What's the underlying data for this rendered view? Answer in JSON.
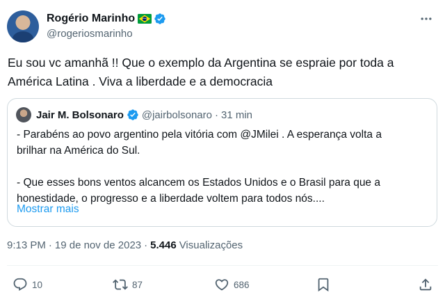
{
  "author": {
    "display_name": "Rogério Marinho",
    "handle": "@rogeriosmarinho"
  },
  "tweet": {
    "text": "Eu sou vc amanhã !! Que o exemplo da Argentina se espraie por toda a América Latina . Viva a liberdade e a democracia"
  },
  "quote": {
    "display_name": "Jair M. Bolsonaro",
    "handle": "@jairbolsonaro",
    "separator": "·",
    "time": "31 min",
    "lines": [
      "- Parabéns ao povo argentino pela vitória com @JMilei . A esperança volta a",
      "brilhar na América do Sul.",
      "",
      "- Que esses bons ventos alcancem os Estados Unidos e o Brasil para que a",
      "honestidade, o progresso e a liberdade voltem para todos nós...."
    ],
    "show_more": "Mostrar mais"
  },
  "meta": {
    "time": "9:13 PM",
    "separator": "·",
    "date": "19 de nov de 2023",
    "separator2": "·",
    "views_count": "5.446",
    "views_label": "Visualizações"
  },
  "actions": {
    "reply_count": "10",
    "retweet_count": "87",
    "like_count": "686"
  },
  "icons": {
    "verified": "verified-badge-icon",
    "flag": "brazil-flag-icon",
    "more": "more-options-icon",
    "reply": "reply-icon",
    "retweet": "retweet-icon",
    "like": "heart-icon",
    "bookmark": "bookmark-icon",
    "share": "share-icon"
  },
  "colors": {
    "accent": "#1d9bf0",
    "text": "#0f1419",
    "secondary": "#536471",
    "border": "#cfd9de"
  }
}
